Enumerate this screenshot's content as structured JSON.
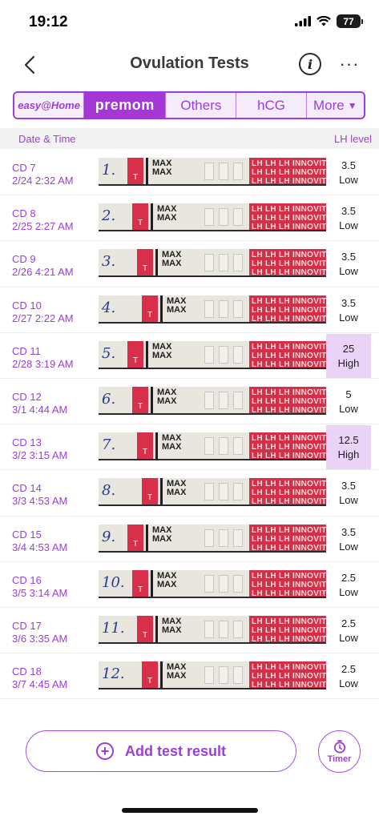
{
  "status_bar": {
    "time": "19:12",
    "battery": "77"
  },
  "nav": {
    "title": "Ovulation Tests",
    "info_glyph": "i",
    "more_glyph": "···"
  },
  "brand_tabs": [
    {
      "label": "easy@Home"
    },
    {
      "label": "premom"
    },
    {
      "label": "Others"
    },
    {
      "label": "hCG"
    },
    {
      "label": "More",
      "arrow": "▼"
    }
  ],
  "table": {
    "date_header": "Date & Time",
    "lh_header": "LH level",
    "strip_max_text": "MAX",
    "strip_t_text": "T",
    "strip_brand_text": "LH LH LH INNOVITA L",
    "rows": [
      {
        "cd": "CD 7",
        "date": "2/24 2:32 AM",
        "num": "1.",
        "lh": "3.5",
        "level": "Low"
      },
      {
        "cd": "CD 8",
        "date": "2/25 2:27 AM",
        "num": "2.",
        "lh": "3.5",
        "level": "Low"
      },
      {
        "cd": "CD 9",
        "date": "2/26 4:21 AM",
        "num": "3.",
        "lh": "3.5",
        "level": "Low"
      },
      {
        "cd": "CD 10",
        "date": "2/27 2:22 AM",
        "num": "4.",
        "lh": "3.5",
        "level": "Low"
      },
      {
        "cd": "CD 11",
        "date": "2/28 3:19 AM",
        "num": "5.",
        "lh": "25",
        "level": "High"
      },
      {
        "cd": "CD 12",
        "date": "3/1 4:44 AM",
        "num": "6.",
        "lh": "5",
        "level": "Low"
      },
      {
        "cd": "CD 13",
        "date": "3/2 3:15 AM",
        "num": "7.",
        "lh": "12.5",
        "level": "High"
      },
      {
        "cd": "CD 14",
        "date": "3/3 4:53 AM",
        "num": "8.",
        "lh": "3.5",
        "level": "Low"
      },
      {
        "cd": "CD 15",
        "date": "3/4 4:53 AM",
        "num": "9.",
        "lh": "3.5",
        "level": "Low"
      },
      {
        "cd": "CD 16",
        "date": "3/5 3:14 AM",
        "num": "10.",
        "lh": "2.5",
        "level": "Low"
      },
      {
        "cd": "CD 17",
        "date": "3/6 3:35 AM",
        "num": "11.",
        "lh": "2.5",
        "level": "Low"
      },
      {
        "cd": "CD 18",
        "date": "3/7 4:45 AM",
        "num": "12.",
        "lh": "2.5",
        "level": "Low"
      }
    ]
  },
  "actions": {
    "add_label": "Add test result",
    "timer_label": "Timer"
  },
  "colors": {
    "accent": "#9b3fd6",
    "high_bg": "#e9d4f7",
    "strip_red": "#d32f46"
  }
}
